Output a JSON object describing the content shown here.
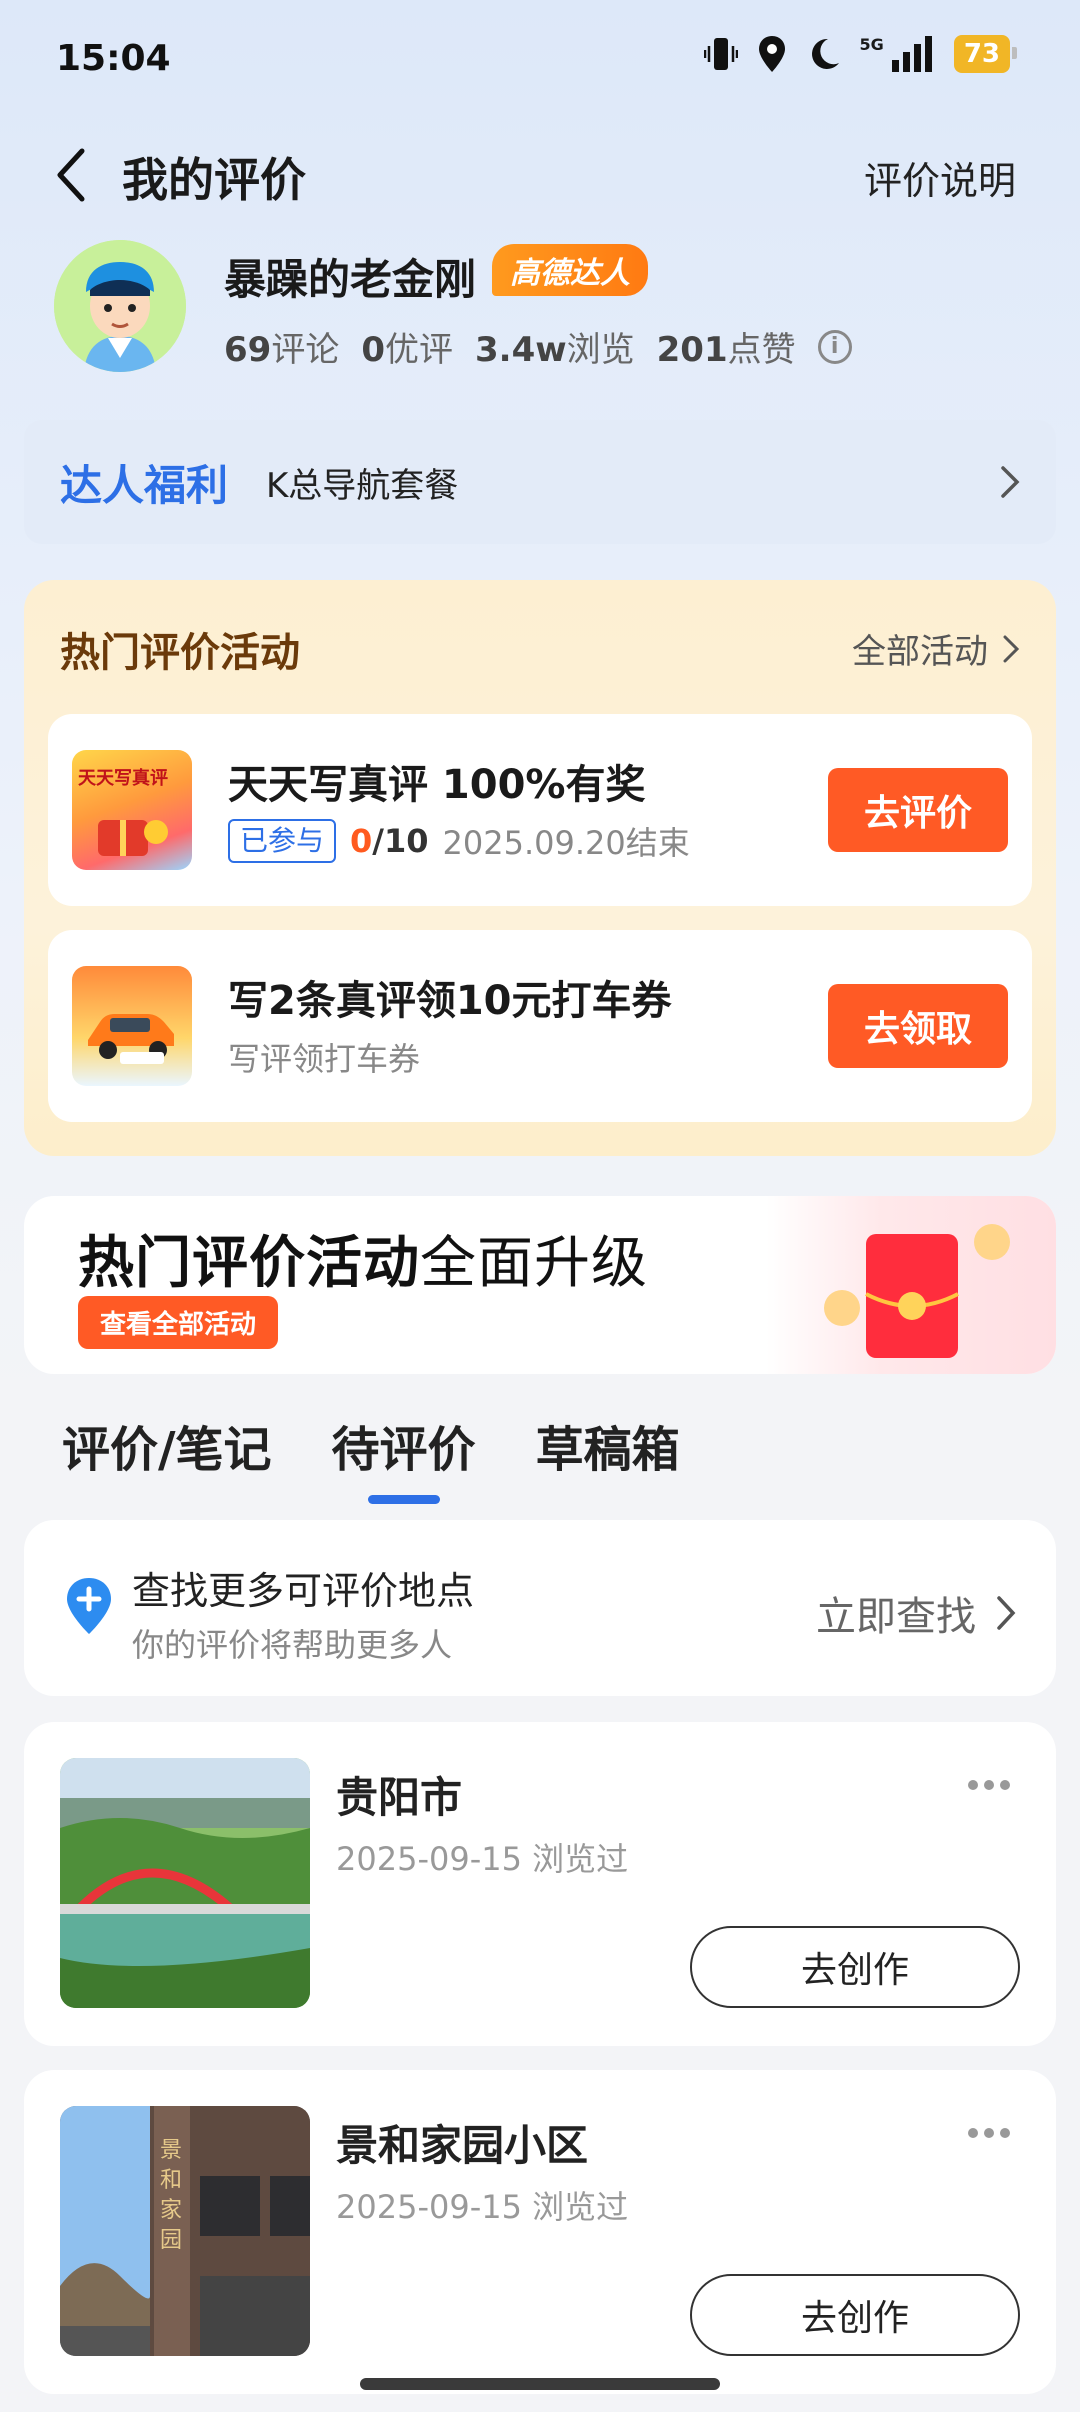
{
  "status": {
    "time": "15:04",
    "network": "5G",
    "battery": "73"
  },
  "header": {
    "title": "我的评价",
    "help": "评价说明"
  },
  "profile": {
    "name": "暴躁的老金刚",
    "badge": "高德达人",
    "stats": [
      {
        "value": "69",
        "label": "评论"
      },
      {
        "value": "0",
        "label": "优评"
      },
      {
        "value": "3.4w",
        "label": "浏览"
      },
      {
        "value": "201",
        "label": "点赞"
      }
    ]
  },
  "perk": {
    "title": "达人福利",
    "text": "K总导航套餐"
  },
  "activities": {
    "title": "热门评价活动",
    "all": "全部活动",
    "items": [
      {
        "title": "天天写真评 100%有奖",
        "tag": "已参与",
        "progress_current": "0",
        "progress_total": "/10",
        "end": "2025.09.20结束",
        "button": "去评价",
        "image_text": "天天写真评"
      },
      {
        "title": "写2条真评领10元打车券",
        "sub": "写评领打车券",
        "button": "去领取"
      }
    ]
  },
  "banner": {
    "title_bold": "热门评价活动",
    "title_light": "全面升级",
    "button": "查看全部活动"
  },
  "tabs": [
    "评价/笔记",
    "待评价",
    "草稿箱"
  ],
  "active_tab": "待评价",
  "find": {
    "title": "查找更多可评价地点",
    "sub": "你的评价将帮助更多人",
    "action": "立即查找"
  },
  "places": [
    {
      "name": "贵阳市",
      "date": "2025-09-15 浏览过",
      "button": "去创作"
    },
    {
      "name": "景和家园小区",
      "date": "2025-09-15 浏览过",
      "button": "去创作",
      "image_text": "景和家园"
    }
  ],
  "colors": {
    "accent": "#2d6fe6",
    "cta": "#ff5a25",
    "badge": "#ff8a17"
  }
}
